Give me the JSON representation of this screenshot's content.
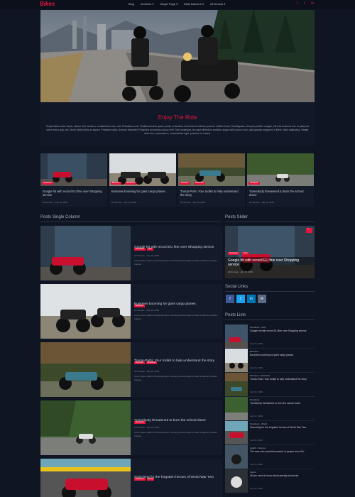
{
  "header": {
    "logo": "Bikes",
    "nav": [
      "Blog",
      "Archives ▾",
      "Single Page ▾",
      "Main Banners ▾",
      "All Demos ▾"
    ]
  },
  "intro": {
    "title": "Enjoy The Ride",
    "text": "Suspendisse enim turpis, dictum sed, iaculis a, condimentum nec, nisi. Phasellus a est. Vestibulum ante ipsum primis in faucibus orci luctus et ultrices posuere cubilia Curae; Sed aliquam, nisi quis porttitor congue, elit erat euismod orci, ac placerat dolor lectus quis orci. Morbi mollis tellus ac sapien. Praesent turpis. Aenean imperdiet. Phasellus accumsan cursus velit. Sed consequat, leo eget bibendum sodales, augue velit cursus nunc, quis gravida magna mi a libero. Nam adipiscing. Integer ante arcu, accumsan a, consectetuer eget, posuere ut, mauris."
  },
  "cards": [
    {
      "tag": "Newsbeat",
      "title": "Google hit with record EU fine over Shopping service",
      "author": "AF themes",
      "date": "July 16, 2019"
    },
    {
      "tag": "Business",
      "tag2": "Newsbeat",
      "title": "Business booming for giant cargo planes",
      "author": "AF themes",
      "date": "July 16, 2019"
    },
    {
      "tag": "Business",
      "tag2": "Newsbeat",
      "title": "Trump-Putin: Your toolkit to help understand the story",
      "author": "AF themes",
      "date": "July 16, 2019"
    },
    {
      "tag": "Newsbeat",
      "title": "'Somebody threatened to burn the school down'",
      "author": "AF themes",
      "date": "July 16, 2019"
    }
  ],
  "sections": {
    "posts_single": "Posts Single Column",
    "posts_slider": "Posts Slider",
    "social_links": "Social Links",
    "posts_lists": "Posts Lists"
  },
  "posts": [
    {
      "tags": [
        "Newsbeat",
        "Tech"
      ],
      "title": "Google hit with record EU fine over Shopping service",
      "author": "AF themes",
      "date": "July 16, 2019",
      "excerpt": "Lorem ipsum dolor sit amet,sed diam nonumy eirmod tempor invidunt ut labore et dolore magna..."
    },
    {
      "tags": [
        "Business"
      ],
      "title": "Business booming for giant cargo planes",
      "author": "AF themes",
      "date": "July 16, 2019",
      "excerpt": "Lorem ipsum dolor sit amet,sed diam nonumy eirmod tempor invidunt ut labore et dolore magna..."
    },
    {
      "tags": [
        "Business",
        "Newsbeat"
      ],
      "title": "Trump-Putin: Your toolkit to help understand the story",
      "author": "AF themes",
      "date": "July 16, 2019",
      "excerpt": "Lorem ipsum dolor sit amet,sed diam nonumy eirmod tempor invidunt ut labore et dolore magna..."
    },
    {
      "tags": [
        "Newsbeat"
      ],
      "title": "'Somebody threatened to burn the school down'",
      "author": "AF themes",
      "date": "July 16, 2019",
      "excerpt": "Lorem ipsum dolor sit amet,sed diam nonumy eirmod tempor invidunt ut labore et dolore magna..."
    },
    {
      "tags": [
        "Newsbeat",
        "World"
      ],
      "title": "Searching for the forgotten heroes of World War Two",
      "author": "",
      "date": "",
      "excerpt": ""
    }
  ],
  "slider": {
    "tags": [
      "Newsbeat",
      "Tech"
    ],
    "title": "Google hit with record EU fine over Shopping service",
    "author": "AF themes",
    "date": "July 16, 2019"
  },
  "social": [
    "f",
    "t",
    "in",
    "✉"
  ],
  "post_list": [
    {
      "cat": "Newsbeat - Tech",
      "title": "Google hit with record EU fine over Shopping service",
      "date": "July 16, 2019"
    },
    {
      "cat": "Business",
      "title": "Business booming for giant cargo planes",
      "date": "July 16, 2019"
    },
    {
      "cat": "Business - Newsbeat",
      "title": "Trump-Putin: Your toolkit to help understand the story",
      "date": "July 16, 2019"
    },
    {
      "cat": "Newsbeat",
      "title": "'Somebody threatened to burn the school down'",
      "date": "July 16, 2019"
    },
    {
      "cat": "Newsbeat - World",
      "title": "Searching for the forgotten heroes of World War Two",
      "date": "July 16, 2019"
    },
    {
      "cat": "Health - Science",
      "title": "The man who saved thousands of people from HIV",
      "date": "July 16, 2019"
    },
    {
      "cat": "Sports",
      "title": "All you need to know about penalty shootouts",
      "date": "July 16, 2019"
    }
  ],
  "colors": {
    "accent": "#e5163e",
    "bg": "#0f1522",
    "facebook": "#3b5998",
    "twitter": "#1da1f2",
    "linkedin": "#0077b5",
    "email": "#5a6a86"
  }
}
